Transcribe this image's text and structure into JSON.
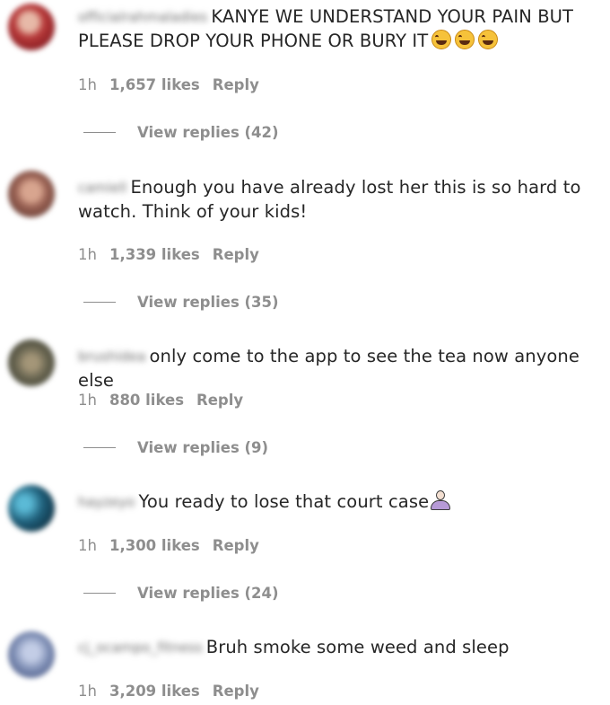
{
  "comments": [
    {
      "username": "officialrahmaladies",
      "text": "KANYE WE UNDERSTAND YOUR PAIN BUT PLEASE DROP YOUR PHONE OR BURY IT",
      "emoji": [
        "face-with-tears-of-joy",
        "face-with-tears-of-joy",
        "face-with-tears-of-joy"
      ],
      "time": "1h",
      "likes": "1,657 likes",
      "reply": "Reply",
      "view_replies": "View replies (42)",
      "avatar_color": "#b83a3a"
    },
    {
      "username": "camiell",
      "text": "Enough you have already lost her this is so hard to watch. Think of your kids!",
      "time": "1h",
      "likes": "1,339 likes",
      "reply": "Reply",
      "view_replies": "View replies (35)",
      "avatar_color": "#9b6355"
    },
    {
      "username": "brushidea",
      "text": "only come to the app to see the tea now anyone else",
      "time": "1h",
      "likes": "880 likes",
      "reply": "Reply",
      "view_replies": "View replies (9)",
      "avatar_color": "#6e6a55"
    },
    {
      "username": "hayzeyo",
      "text": "You ready to lose that court case",
      "emoji": [
        "person-facepalming"
      ],
      "time": "1h",
      "likes": "1,300 likes",
      "reply": "Reply",
      "view_replies": "View replies (24)",
      "avatar_color": "#1f5f7a"
    },
    {
      "username": "cj_ocampo_fitness",
      "text": "Bruh smoke some weed and sleep",
      "time": "1h",
      "likes": "3,209 likes",
      "reply": "Reply",
      "avatar_color": "#7f8fb5"
    }
  ]
}
